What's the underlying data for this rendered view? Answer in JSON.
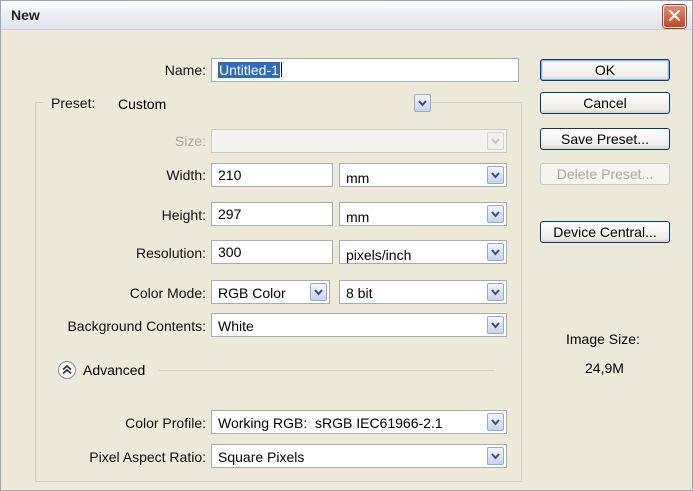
{
  "window": {
    "title": "New"
  },
  "name": {
    "label": "Name:",
    "value": "Untitled-1"
  },
  "preset": {
    "label": "Preset:",
    "value": "Custom"
  },
  "size": {
    "label": "Size:",
    "value": ""
  },
  "width": {
    "label": "Width:",
    "value": "210",
    "unit": "mm"
  },
  "height": {
    "label": "Height:",
    "value": "297",
    "unit": "mm"
  },
  "resolution": {
    "label": "Resolution:",
    "value": "300",
    "unit": "pixels/inch"
  },
  "color_mode": {
    "label": "Color Mode:",
    "value": "RGB Color",
    "depth": "8 bit"
  },
  "background": {
    "label": "Background Contents:",
    "value": "White"
  },
  "advanced": {
    "label": "Advanced",
    "expanded": true
  },
  "color_profile": {
    "label": "Color Profile:",
    "value": "Working RGB:  sRGB IEC61966-2.1"
  },
  "pixel_aspect": {
    "label": "Pixel Aspect Ratio:",
    "value": "Square Pixels"
  },
  "buttons": {
    "ok": "OK",
    "cancel": "Cancel",
    "save_preset": "Save Preset...",
    "delete_preset": "Delete Preset...",
    "device_central": "Device Central..."
  },
  "image_size": {
    "label": "Image Size:",
    "value": "24,9M"
  },
  "icons": {
    "close": "close-icon",
    "dropdown": "chevron-down-icon",
    "advanced_toggle": "chevron-up-circle-icon"
  },
  "colors": {
    "dialog_bg": "#ece9d8",
    "button_border": "#003c74",
    "close_red": "#c9431f"
  }
}
